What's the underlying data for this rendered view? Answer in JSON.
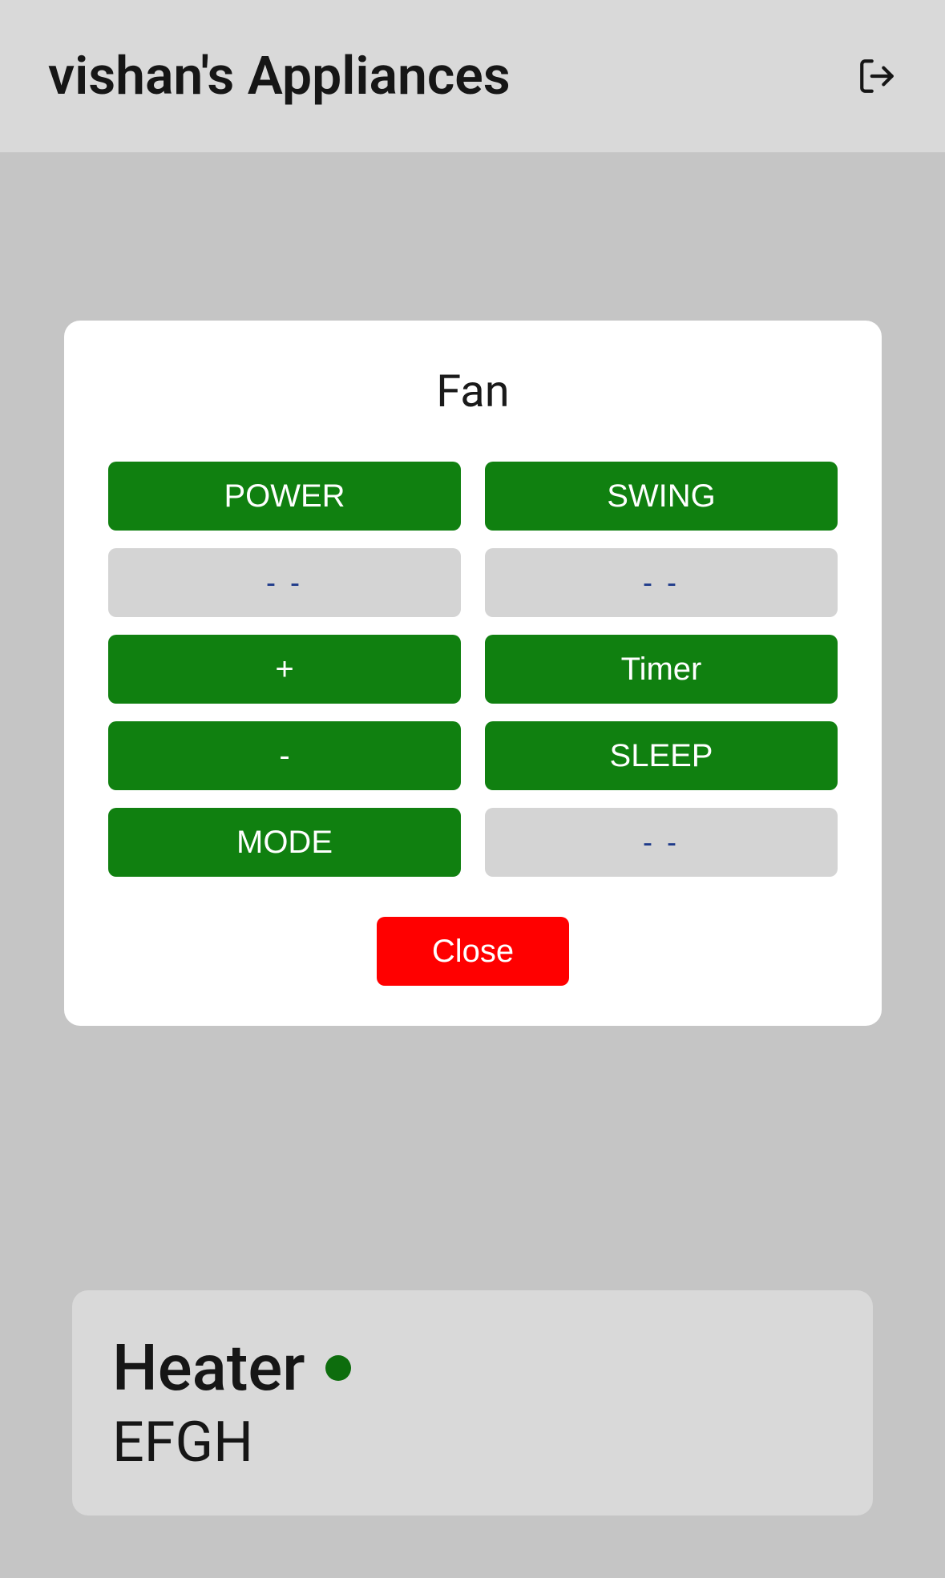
{
  "header": {
    "title": "vishan's Appliances"
  },
  "modal": {
    "title": "Fan",
    "buttons": {
      "power": "POWER",
      "swing": "SWING",
      "empty1": "- -",
      "empty2": "- -",
      "plus": "+",
      "timer": "Timer",
      "minus": "-",
      "sleep": "SLEEP",
      "mode": "MODE",
      "empty3": "- -"
    },
    "close_label": "Close"
  },
  "card": {
    "title": "Heater",
    "subtitle": "EFGH"
  }
}
